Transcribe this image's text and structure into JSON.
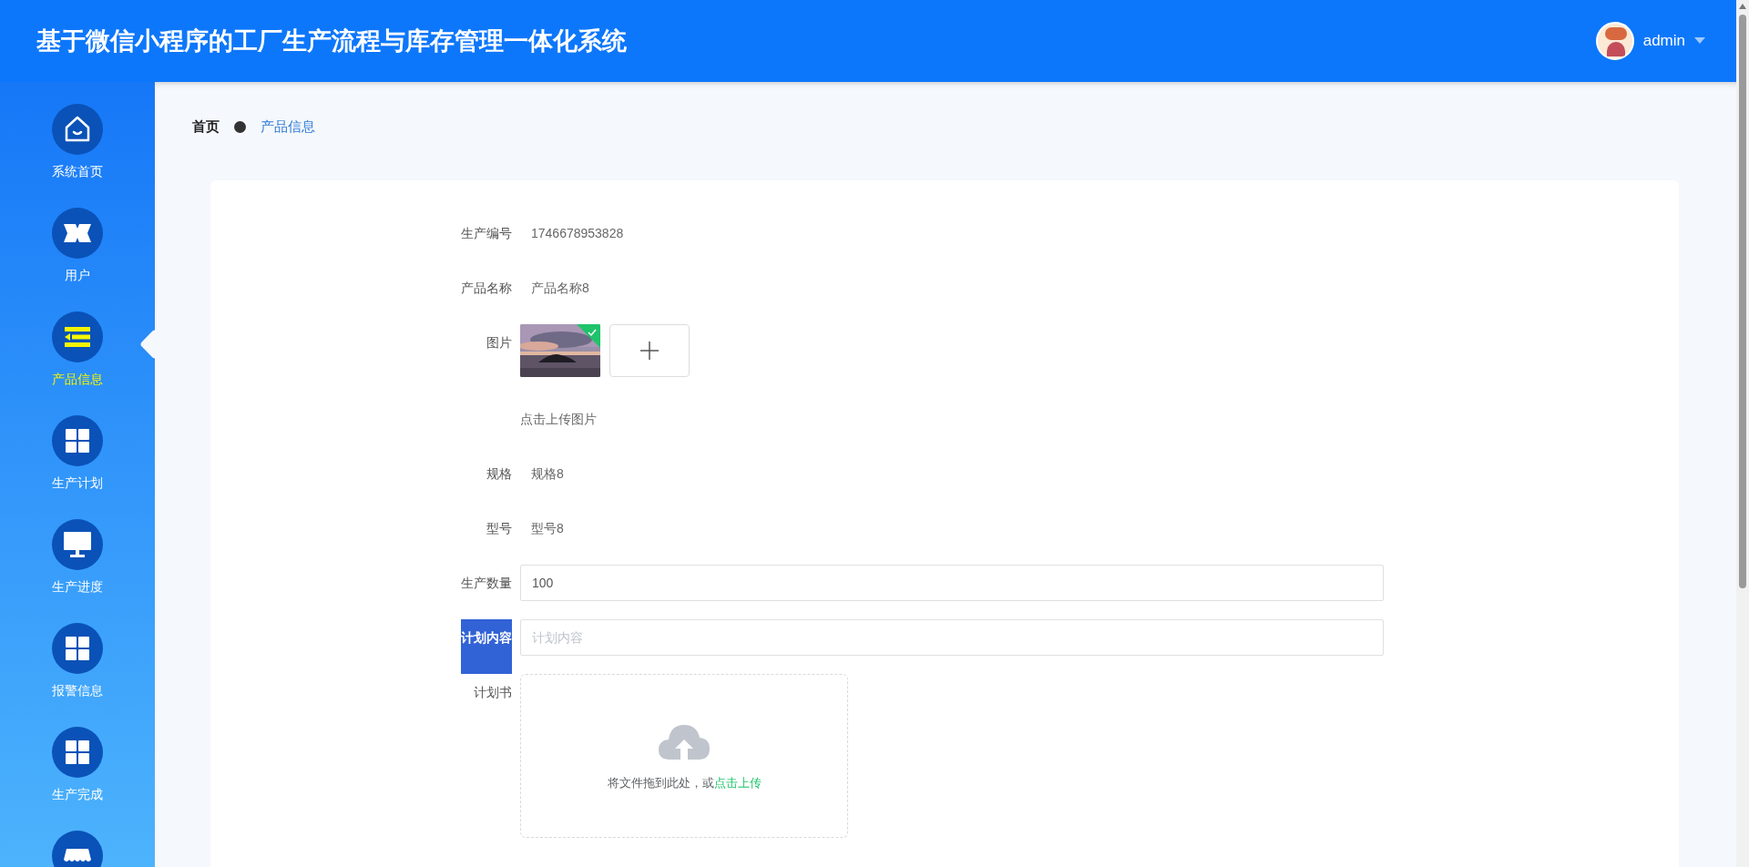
{
  "header": {
    "title": "基于微信小程序的工厂生产流程与库存管理一体化系统",
    "user": "admin"
  },
  "sidebar": {
    "items": [
      {
        "label": "系统首页",
        "kind": "home",
        "selected": false
      },
      {
        "label": "用户",
        "kind": "ticket",
        "selected": false
      },
      {
        "label": "产品信息",
        "kind": "list",
        "selected": true
      },
      {
        "label": "生产计划",
        "kind": "grid",
        "selected": false
      },
      {
        "label": "生产进度",
        "kind": "monitor",
        "selected": false
      },
      {
        "label": "报警信息",
        "kind": "grid",
        "selected": false
      },
      {
        "label": "生产完成",
        "kind": "grid",
        "selected": false
      },
      {
        "kind": "shop",
        "selected": false
      }
    ]
  },
  "breadcrumb": [
    {
      "label": "首页",
      "kind": "root"
    },
    {
      "label": "产品信息",
      "kind": "current"
    }
  ],
  "form": {
    "fields": [
      {
        "kind": "text",
        "label": "生产编号",
        "value": "1746678953828"
      },
      {
        "kind": "text",
        "label": "产品名称",
        "value": "产品名称8"
      },
      {
        "label": "图片",
        "uploaded": true,
        "hint": "点击上传图片"
      },
      {
        "kind": "text",
        "label": "规格",
        "value": "规格8"
      },
      {
        "kind": "text",
        "label": "型号",
        "value": "型号8"
      },
      {
        "kind": "input",
        "label": "生产数量",
        "value": "100",
        "highlighted": false
      },
      {
        "kind": "input",
        "label": "计划内容",
        "placeholder": "计划内容",
        "highlighted": true
      },
      {
        "kind": "file",
        "label": "计划书",
        "prompt": "将文件拖到此处，或",
        "link": "点击上传"
      }
    ]
  }
}
